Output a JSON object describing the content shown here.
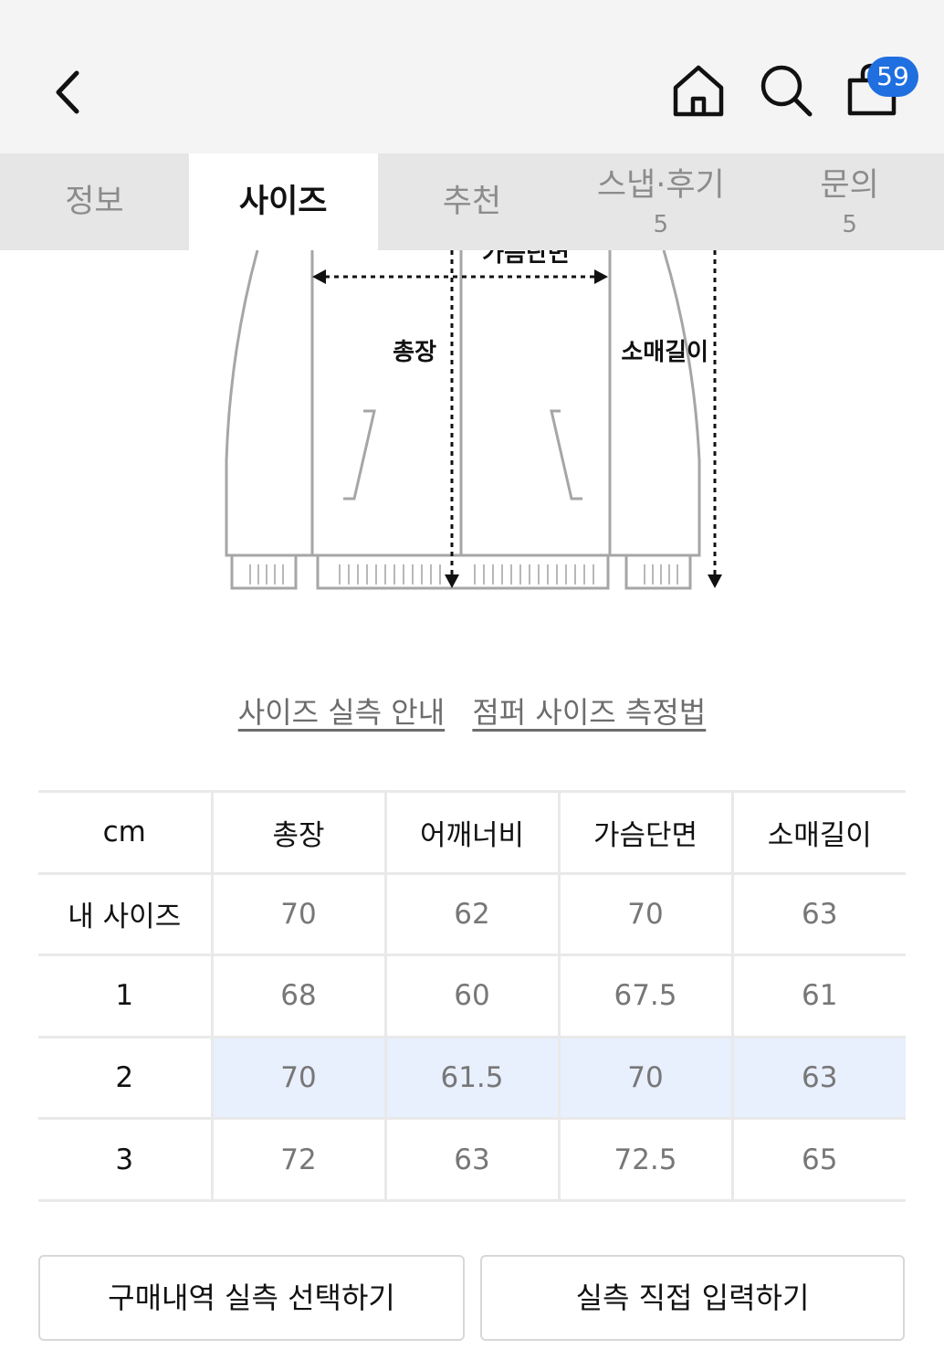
{
  "header": {
    "back_icon": "chevron-left-icon",
    "home_icon": "home-icon",
    "search_icon": "search-icon",
    "cart_icon": "shopping-bag-icon",
    "cart_count": "59",
    "badge_color": "#1f6fe0"
  },
  "tabs": [
    {
      "label": "정보",
      "count": ""
    },
    {
      "label": "사이즈",
      "count": ""
    },
    {
      "label": "추천",
      "count": ""
    },
    {
      "label": "스냅·후기",
      "count": "5"
    },
    {
      "label": "문의",
      "count": "5"
    }
  ],
  "diagram": {
    "labels": {
      "chest": "가슴단면",
      "length": "총장",
      "sleeve": "소매길이"
    }
  },
  "links": {
    "size_guide": "사이즈 실측 안내",
    "measure_method": "점퍼 사이즈 측정법"
  },
  "size_table": {
    "headers": [
      "cm",
      "총장",
      "어깨너비",
      "가슴단면",
      "소매길이"
    ],
    "rows": [
      {
        "label": "내 사이즈",
        "values": [
          "70",
          "62",
          "70",
          "63"
        ]
      },
      {
        "label": "1",
        "values": [
          "68",
          "60",
          "67.5",
          "61"
        ]
      },
      {
        "label": "2",
        "values": [
          "70",
          "61.5",
          "70",
          "63"
        ]
      },
      {
        "label": "3",
        "values": [
          "72",
          "63",
          "72.5",
          "65"
        ]
      }
    ],
    "highlight_color": "#e8effd"
  },
  "buttons": {
    "purchase_history": "구매내역 실측 선택하기",
    "direct_input": "실측 직접 입력하기"
  }
}
